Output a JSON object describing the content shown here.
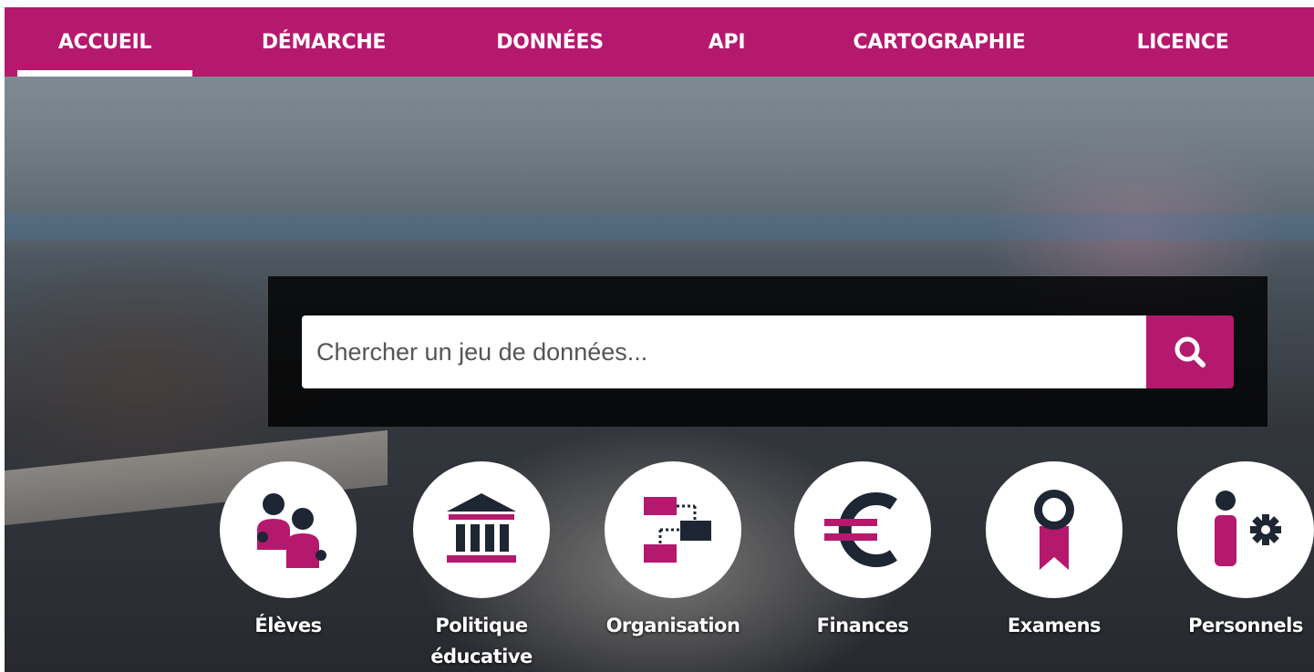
{
  "nav": {
    "items": [
      {
        "label": "ACCUEIL",
        "active": true
      },
      {
        "label": "DÉMARCHE"
      },
      {
        "label": "DONNÉES"
      },
      {
        "label": "API"
      },
      {
        "label": "CARTOGRAPHIE"
      },
      {
        "label": "LICENCE"
      }
    ]
  },
  "search": {
    "placeholder": "Chercher un jeu de données...",
    "value": "",
    "button_icon": "search-icon"
  },
  "categories": [
    {
      "label": "Élèves",
      "icon": "students-icon"
    },
    {
      "label": "Politique éducative",
      "icon": "institution-icon"
    },
    {
      "label": "Organisation",
      "icon": "organization-chart-icon"
    },
    {
      "label": "Finances",
      "icon": "euro-icon"
    },
    {
      "label": "Examens",
      "icon": "award-ribbon-icon"
    },
    {
      "label": "Personnels",
      "icon": "staff-settings-icon"
    }
  ],
  "colors": {
    "accent": "#b5196e",
    "dark": "#1e2633",
    "white": "#ffffff"
  }
}
